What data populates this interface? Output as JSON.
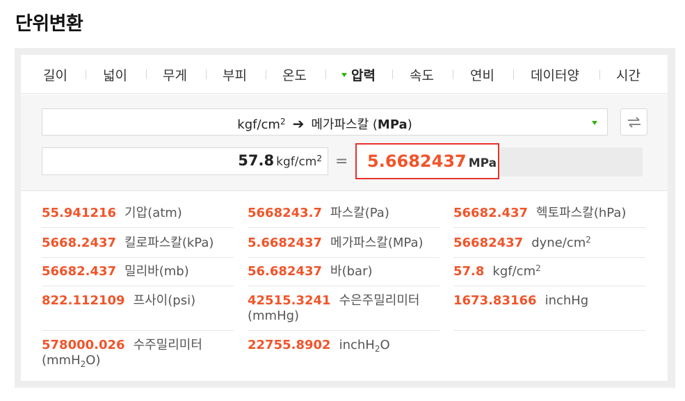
{
  "page": {
    "title": "단위변환"
  },
  "tabs": [
    {
      "label": "길이"
    },
    {
      "label": "넓이"
    },
    {
      "label": "무게"
    },
    {
      "label": "부피"
    },
    {
      "label": "온도"
    },
    {
      "label": "압력",
      "active": true
    },
    {
      "label": "속도"
    },
    {
      "label": "연비"
    },
    {
      "label": "데이터양"
    },
    {
      "label": "시간"
    }
  ],
  "selector": {
    "from_unit": "kgf/cm",
    "from_unit_sup": "2",
    "arrow": "➔",
    "to_unit_prefix": "메가파스칼 (",
    "to_unit_bold": "MPa",
    "to_unit_suffix": ")"
  },
  "input": {
    "value": "57.8",
    "unit": "kgf/cm",
    "unit_sup": "2"
  },
  "equals": "=",
  "result": {
    "value": "5.6682437",
    "unit": "MPa"
  },
  "results": [
    {
      "value": "55.941216",
      "unit": "기압(atm)"
    },
    {
      "value": "5668243.7",
      "unit": "파스칼(Pa)"
    },
    {
      "value": "56682.437",
      "unit": "헥토파스칼(hPa)"
    },
    {
      "value": "5668.2437",
      "unit": "킬로파스칼(kPa)"
    },
    {
      "value": "5.6682437",
      "unit": "메가파스칼(MPa)"
    },
    {
      "value": "56682437",
      "unit": "dyne/cm",
      "unit_sup": "2"
    },
    {
      "value": "56682.437",
      "unit": "밀리바(mb)"
    },
    {
      "value": "56.682437",
      "unit": "바(bar)"
    },
    {
      "value": "57.8",
      "unit": "kgf/cm",
      "unit_sup": "2"
    },
    {
      "value": "822.112109",
      "unit": "프사이(psi)"
    },
    {
      "value": "42515.3241",
      "unit": "수은주밀리미터",
      "unit_line2": "(mmHg)"
    },
    {
      "value": "1673.83166",
      "unit": "inchHg"
    },
    {
      "value": "578000.026",
      "unit": "수주밀리미터",
      "unit_line2_a": "(mmH",
      "unit_line2_sub": "2",
      "unit_line2_b": "O)"
    },
    {
      "value": "22755.8902",
      "unit": "inchH",
      "unit_sub": "2",
      "unit_b": "O"
    }
  ],
  "colors": {
    "accent_orange": "#f0552a",
    "highlight_border": "#e8302b",
    "tab_marker": "#2db400"
  }
}
